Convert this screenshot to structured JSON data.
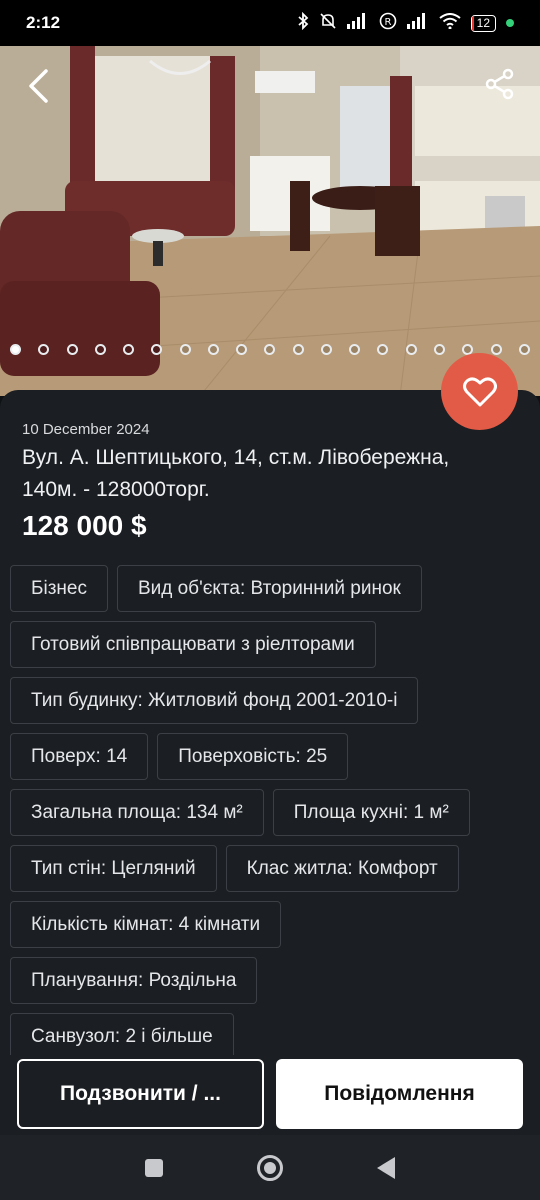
{
  "status_bar": {
    "time": "2:12",
    "icons": [
      "bluetooth-icon",
      "mute-icon",
      "signal-icon",
      "roaming-icon",
      "signal-icon",
      "wifi-icon"
    ],
    "battery_level": "12",
    "battery_fraction": 0.12,
    "battery_color": "#e53935",
    "dot_color": "#33d17a"
  },
  "gallery": {
    "image_alt_note": "",
    "slide_count": 19,
    "active_slide": 1
  },
  "listing": {
    "date": "10 December 2024",
    "title": "Вул. А. Шептицького, 14,  ст.м. Лівобережна, 140м. - 128000торг.",
    "price": "128 000 $"
  },
  "chips": [
    [
      "Бізнес",
      "Вид об'єкта: Вторинний ринок"
    ],
    [
      "Готовий співпрацювати з ріелторами"
    ],
    [
      "Тип будинку: Житловий фонд 2001-2010-і"
    ],
    [
      "Поверх: 14",
      "Поверховість: 25"
    ],
    [
      "Загальна площа: 134 м²",
      "Площа кухні: 1 м²"
    ],
    [
      "Тип стін: Цегляний",
      "Клас житла: Комфорт"
    ],
    [
      "Кількість кімнат: 4 кімнати"
    ],
    [
      "Планування: Роздільна"
    ],
    [
      "Санвузол: 2 і більше"
    ]
  ],
  "actions": {
    "call_label": "Подзвонити / ...",
    "message_label": "Повідомлення"
  },
  "colors": {
    "favorite": "#e25b46",
    "panel": "#1b1e22"
  }
}
